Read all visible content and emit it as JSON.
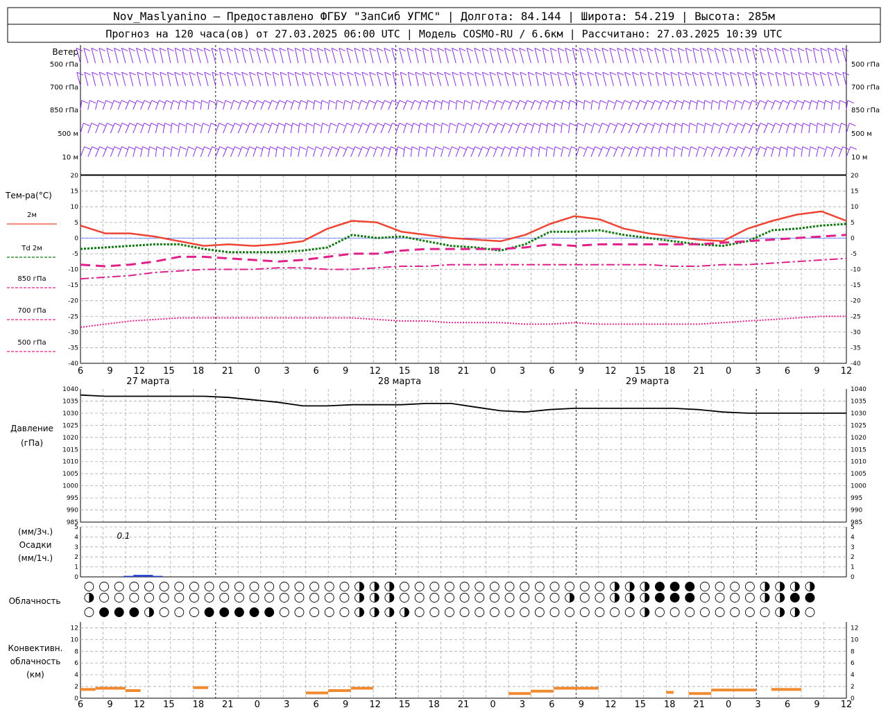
{
  "header": {
    "line1": "Nov_Maslyanino — Предоставлено ФГБУ \"ЗапСиб УГМС\" | Долгота: 84.144 | Широта: 54.219 | Высота: 285м",
    "line2": "Прогноз на 120 часа(ов) от 27.03.2025 06:00 UTC  | Модель COSMO-RU / 6.6км | Рассчитано: 27.03.2025 10:39 UTC"
  },
  "panels": {
    "wind": {
      "title": "Ветер",
      "levels": [
        "500 гПа",
        "700 гПа",
        "850 гПа",
        "500 м",
        "10  м"
      ],
      "color": "#8a2be2"
    },
    "temperature": {
      "title": "Тем-ра(°C)",
      "legend": [
        "2м",
        "Td  2м",
        "850 гПа",
        "700 гПа",
        "500 гПа"
      ],
      "yticks": [
        "20",
        "15",
        "10",
        "5",
        "0",
        "-5",
        "-10",
        "-15",
        "-20",
        "-25",
        "-30",
        "-35",
        "-40"
      ]
    },
    "pressure": {
      "title": "Давление",
      "unit": "(гПа)",
      "yticks": [
        "1040",
        "1035",
        "1030",
        "1025",
        "1020",
        "1015",
        "1010",
        "1005",
        "1000",
        "995",
        "990",
        "985"
      ]
    },
    "precip": {
      "title_lines": [
        "(мм/3ч.)",
        "Осадки",
        "(мм/1ч.)"
      ],
      "yticks": [
        "5",
        "4",
        "3",
        "2",
        "1",
        "0"
      ],
      "annotation": "0.1"
    },
    "clouds": {
      "title": "Облачность"
    },
    "convective": {
      "title_lines": [
        "Конвективн.",
        "облачность",
        "(км)"
      ],
      "yticks": [
        "12",
        "10",
        "8",
        "6",
        "4",
        "2",
        "0"
      ]
    }
  },
  "x_axis": {
    "ticks": [
      "6",
      "9",
      "12",
      "15",
      "18",
      "21",
      "0",
      "3",
      "6",
      "9",
      "12",
      "15",
      "18",
      "21",
      "0",
      "3",
      "6",
      "9",
      "12",
      "15",
      "18",
      "21",
      "0",
      "3",
      "6",
      "9",
      "12"
    ],
    "days": [
      "27 марта",
      "28 марта",
      "29 марта"
    ]
  },
  "chart_data": [
    {
      "type": "line",
      "title": "Тем-ра(°C)",
      "x_hours": [
        0,
        3,
        6,
        9,
        12,
        15,
        18,
        21,
        24,
        27,
        30,
        33,
        36,
        39,
        42,
        45,
        48,
        51,
        54,
        57,
        60,
        63,
        66,
        69,
        72,
        75,
        78
      ],
      "ylim": [
        -40,
        20
      ],
      "series": [
        {
          "name": "2м",
          "color": "#ee4433",
          "style": "solid",
          "values": [
            4,
            1.5,
            1.5,
            0.5,
            -1,
            -2.5,
            -2,
            -2.5,
            -2,
            -1,
            3,
            5.5,
            5,
            2,
            1,
            0,
            -0.5,
            -1,
            1,
            4.5,
            7,
            6,
            3,
            1.5,
            0.5,
            -0.5,
            -1,
            3,
            5.5,
            7.5,
            8.5,
            5.5
          ]
        },
        {
          "name": "Td  2м",
          "color": "#117711",
          "style": "dotted",
          "values": [
            -3.5,
            -3,
            -2.5,
            -2,
            -2,
            -3.5,
            -4.5,
            -4.5,
            -4.5,
            -4,
            -3,
            1,
            0,
            0.5,
            -1,
            -2.5,
            -3,
            -4,
            -2,
            2,
            2,
            2.5,
            1,
            0,
            -1,
            -2,
            -2.5,
            -1,
            2.5,
            3,
            4,
            4.5
          ]
        },
        {
          "name": "850 гПа",
          "color": "#e0208a",
          "style": "dash",
          "values": [
            -8.5,
            -9,
            -8.5,
            -7.5,
            -6,
            -6,
            -6.5,
            -7,
            -7.5,
            -7,
            -6,
            -5,
            -5,
            -4,
            -3.5,
            -3.5,
            -3.5,
            -3.5,
            -3,
            -2,
            -2.5,
            -2,
            -2,
            -2,
            -2,
            -2,
            -1.5,
            -1,
            -0.5,
            0,
            0.5,
            1
          ]
        },
        {
          "name": "700 гПа",
          "color": "#e0208a",
          "style": "dashdot",
          "values": [
            -13,
            -12.5,
            -12,
            -11,
            -10.5,
            -10,
            -10,
            -10,
            -9.5,
            -9.5,
            -10,
            -10,
            -9.5,
            -9,
            -9,
            -8.5,
            -8.5,
            -8.5,
            -8.5,
            -8.5,
            -8.5,
            -8.5,
            -8.5,
            -8.5,
            -9,
            -9,
            -8.5,
            -8.5,
            -8,
            -7.5,
            -7,
            -6.5
          ]
        },
        {
          "name": "500 гПа",
          "color": "#e0208a",
          "style": "fine",
          "values": [
            -28.5,
            -27.5,
            -26.5,
            -26,
            -25.5,
            -25.5,
            -25.5,
            -25.5,
            -25.5,
            -25.5,
            -25.5,
            -25.5,
            -26,
            -26.5,
            -26.5,
            -27,
            -27,
            -27,
            -27.5,
            -27.5,
            -27,
            -27.5,
            -27.5,
            -27.5,
            -27.5,
            -27.5,
            -27,
            -26.5,
            -26,
            -25.5,
            -25,
            -25
          ]
        }
      ]
    },
    {
      "type": "line",
      "title": "Давление",
      "ylabel": "(гПа)",
      "ylim": [
        985,
        1040
      ],
      "series": [
        {
          "name": "Давление",
          "color": "#000000",
          "values": [
            1037.5,
            1037,
            1037,
            1037,
            1037,
            1037,
            1036.5,
            1035.5,
            1034.5,
            1033,
            1033,
            1033.5,
            1033.5,
            1033.5,
            1034,
            1034,
            1032.5,
            1031,
            1030.5,
            1031.5,
            1032,
            1032,
            1032,
            1032,
            1032,
            1031.5,
            1030.5,
            1030,
            1030,
            1030,
            1030,
            1030
          ]
        }
      ]
    },
    {
      "type": "bar",
      "title": "Осадки",
      "ylim": [
        0,
        5
      ],
      "annotation": "0.1",
      "values": [
        {
          "hour": 4,
          "mm": 0.1
        },
        {
          "hour": 5,
          "mm": 0.2
        },
        {
          "hour": 6,
          "mm": 0.2
        },
        {
          "hour": 7,
          "mm": 0.1
        }
      ]
    },
    {
      "type": "bar",
      "title": "Конвективн. облачность (км)",
      "ylim": [
        0,
        13
      ],
      "segments": [
        {
          "from": 0,
          "to": 2,
          "km": 1.5
        },
        {
          "from": 2,
          "to": 6,
          "km": 1.7
        },
        {
          "from": 6,
          "to": 8,
          "km": 1.3
        },
        {
          "from": 15,
          "to": 17,
          "km": 1.8
        },
        {
          "from": 30,
          "to": 33,
          "km": 0.9
        },
        {
          "from": 33,
          "to": 36,
          "km": 1.3
        },
        {
          "from": 36,
          "to": 39,
          "km": 1.7
        },
        {
          "from": 57,
          "to": 60,
          "km": 0.8
        },
        {
          "from": 60,
          "to": 63,
          "km": 1.2
        },
        {
          "from": 63,
          "to": 69,
          "km": 1.7
        },
        {
          "from": 78,
          "to": 79,
          "km": 1.0
        },
        {
          "from": 81,
          "to": 84,
          "km": 0.8
        },
        {
          "from": 84,
          "to": 90,
          "km": 1.4
        },
        {
          "from": 92,
          "to": 96,
          "km": 1.5
        }
      ],
      "color": "#f08a30"
    },
    {
      "type": "table",
      "title": "Облачность",
      "rows": [
        "000000000000000000000000000000000000333333300000000000000000000000000000333333444444400000000333333333",
        "300000000000000000000000000000000000333333300000000000000000000003300000333333444444400000000333444444",
        "044444433000000444444444400000000000333333333000000000000000000000000000000033000000000000000033330000"
      ]
    }
  ]
}
